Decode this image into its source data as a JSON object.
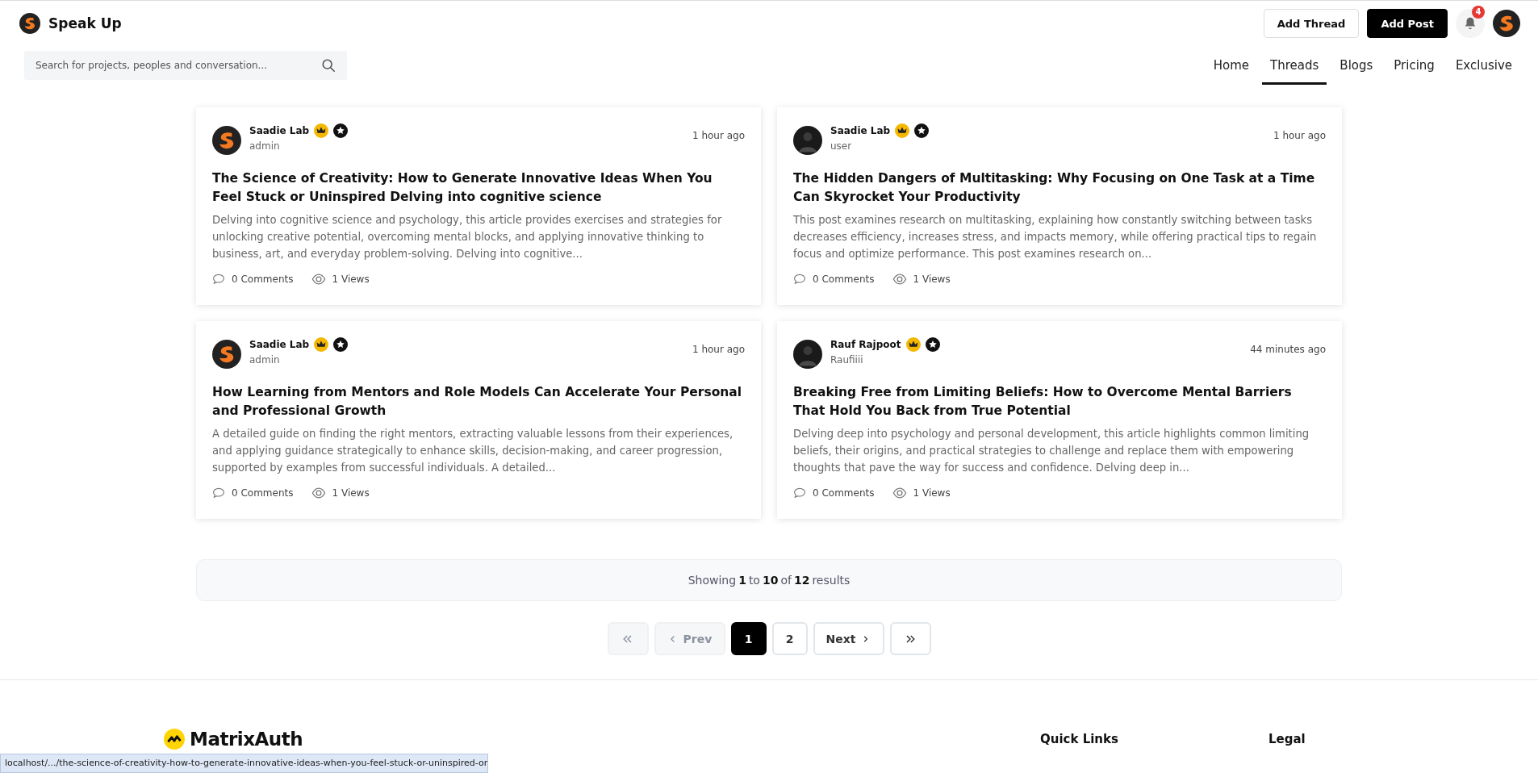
{
  "brand": {
    "name": "Speak Up"
  },
  "header_actions": {
    "add_thread": "Add Thread",
    "add_post": "Add Post",
    "notifications": "4"
  },
  "search": {
    "placeholder": "Search for projects, peoples and conversation..."
  },
  "nav": [
    {
      "label": "Home",
      "selected": false
    },
    {
      "label": "Threads",
      "selected": true
    },
    {
      "label": "Blogs",
      "selected": false
    },
    {
      "label": "Pricing",
      "selected": false
    },
    {
      "label": "Exclusive",
      "selected": false
    }
  ],
  "posts": [
    {
      "author": "Saadie Lab",
      "role": "admin",
      "avatar": {
        "kind": "logo"
      },
      "time": "1 hour ago",
      "title": "The Science of Creativity: How to Generate Innovative Ideas When You Feel Stuck or Uninspired Delving into cognitive science",
      "excerpt": "Delving into cognitive science and psychology, this article provides exercises and strategies for unlocking creative potential, overcoming mental blocks, and applying innovative thinking to business, art, and everyday problem-solving. Delving into cognitive...",
      "comments": "0 Comments",
      "views": "1 Views"
    },
    {
      "author": "Saadie Lab",
      "role": "user",
      "avatar": {
        "kind": "photo"
      },
      "time": "1 hour ago",
      "title": "The Hidden Dangers of Multitasking: Why Focusing on One Task at a Time Can Skyrocket Your Productivity",
      "excerpt": "This post examines research on multitasking, explaining how constantly switching between tasks decreases efficiency, increases stress, and impacts memory, while offering practical tips to regain focus and optimize performance. This post examines research on...",
      "comments": "0 Comments",
      "views": "1 Views"
    },
    {
      "author": "Saadie Lab",
      "role": "admin",
      "avatar": {
        "kind": "logo"
      },
      "time": "1 hour ago",
      "title": "How Learning from Mentors and Role Models Can Accelerate Your Personal and Professional Growth",
      "excerpt": "A detailed guide on finding the right mentors, extracting valuable lessons from their experiences, and applying guidance strategically to enhance skills, decision-making, and career progression, supported by examples from successful individuals. A detailed...",
      "comments": "0 Comments",
      "views": "1 Views"
    },
    {
      "author": "Rauf Rajpoot",
      "role": "Raufiiii",
      "avatar": {
        "kind": "photo"
      },
      "time": "44 minutes ago",
      "title": "Breaking Free from Limiting Beliefs: How to Overcome Mental Barriers That Hold You Back from True Potential",
      "excerpt": "Delving deep into psychology and personal development, this article highlights common limiting beliefs, their origins, and practical strategies to challenge and replace them with empowering thoughts that pave the way for success and confidence. Delving deep in...",
      "comments": "0 Comments",
      "views": "1 Views"
    }
  ],
  "results_summary": "Showing **1** to **10** of **12** results",
  "pagination": [
    {
      "kind": "first",
      "disabled": true,
      "selected": false
    },
    {
      "kind": "prev",
      "label": "Prev",
      "disabled": true,
      "selected": false
    },
    {
      "kind": "page",
      "label": "1",
      "disabled": false,
      "selected": true
    },
    {
      "kind": "page",
      "label": "2",
      "disabled": false,
      "selected": false
    },
    {
      "kind": "next",
      "label": "Next",
      "disabled": false,
      "selected": false
    },
    {
      "kind": "last",
      "disabled": false,
      "selected": false
    }
  ],
  "footer": {
    "brand": "MatrixAuth",
    "columns": [
      "Quick Links",
      "Legal"
    ]
  },
  "status_url": "localhost/.../the-science-of-creativity-how-to-generate-innovative-ideas-when-you-feel-stuck-or-uninspired-or"
}
